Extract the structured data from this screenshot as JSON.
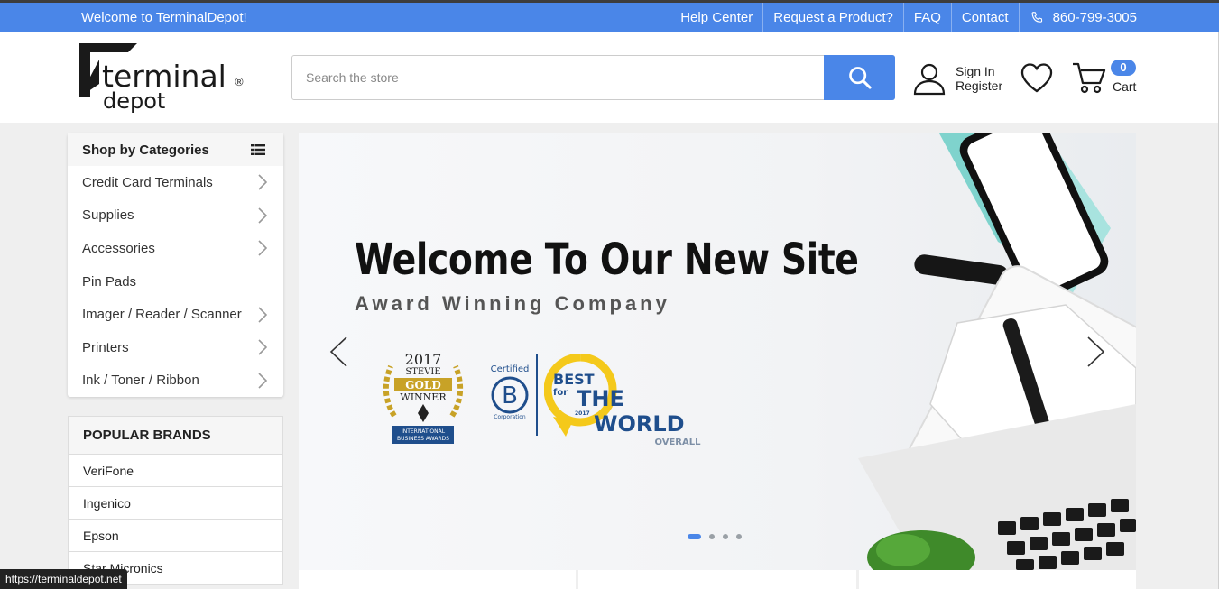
{
  "topbar": {
    "welcome": "Welcome to TerminalDepot!",
    "links": [
      "Help Center",
      "Request a Product?",
      "FAQ",
      "Contact"
    ],
    "phone": "860-799-3005"
  },
  "logo": {
    "line1": "terminal",
    "line2": "depot",
    "mark": "®"
  },
  "search": {
    "placeholder": "Search the store"
  },
  "account": {
    "sign_in": "Sign In",
    "register": "Register"
  },
  "cart": {
    "count": "0",
    "label": "Cart"
  },
  "categories": {
    "title": "Shop by Categories",
    "items": [
      {
        "label": "Credit Card Terminals",
        "arrow": true
      },
      {
        "label": "Supplies",
        "arrow": true
      },
      {
        "label": "Accessories",
        "arrow": true
      },
      {
        "label": "Pin Pads",
        "arrow": false
      },
      {
        "label": "Imager / Reader / Scanner",
        "arrow": true
      },
      {
        "label": "Printers",
        "arrow": true
      },
      {
        "label": "Ink / Toner / Ribbon",
        "arrow": true
      }
    ]
  },
  "brands": {
    "title": "POPULAR BRANDS",
    "items": [
      "VeriFone",
      "Ingenico",
      "Epson",
      "Star Micronics"
    ]
  },
  "hero": {
    "title": "Welcome To Our New Site",
    "subtitle": "Award Winning Company",
    "stevie": {
      "year": "2017",
      "brand": "STEVIE",
      "level": "GOLD",
      "winner": "WINNER",
      "ribbon1": "INTERNATIONAL",
      "ribbon2": "BUSINESS AWARDS"
    },
    "bcorp": {
      "certified": "Certified",
      "letter": "B",
      "corp": "Corporation"
    },
    "best": {
      "best": "BEST",
      "for": "for",
      "the": "THE",
      "world": "WORLD",
      "year": "2017",
      "overall": "OVERALL"
    },
    "slides": 4,
    "active_slide": 1
  },
  "status_url": "https://terminaldepot.net",
  "colors": {
    "brand_blue": "#4a86e8",
    "dark": "#111111"
  }
}
